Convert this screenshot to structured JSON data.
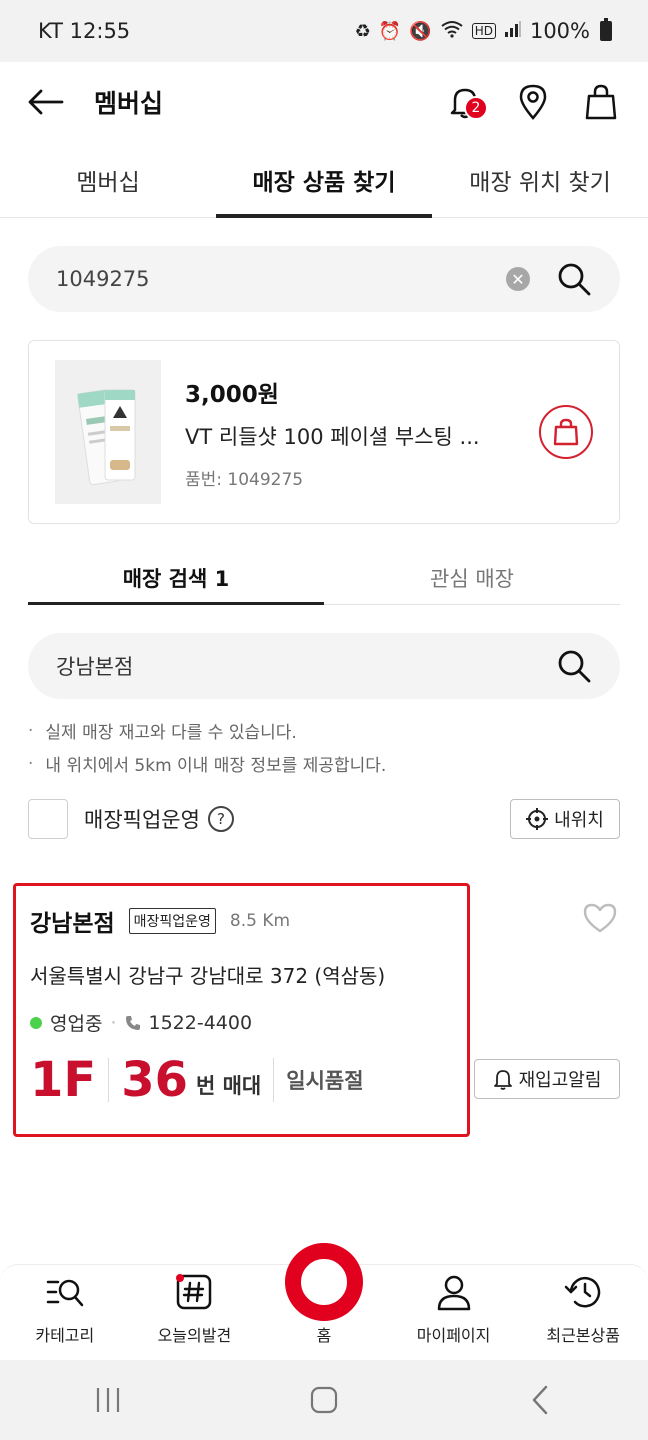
{
  "status_bar": {
    "carrier_time": "KT 12:55",
    "battery": "100%"
  },
  "header": {
    "title": "멤버십",
    "notification_count": "2"
  },
  "tabs": [
    {
      "label": "멤버십"
    },
    {
      "label": "매장 상품 찾기"
    },
    {
      "label": "매장 위치 찾기"
    }
  ],
  "search": {
    "value": "1049275"
  },
  "product": {
    "price": "3,000원",
    "name": "VT 리들샷 100 페이셜 부스팅 ...",
    "code": "품번: 1049275"
  },
  "store_tabs": [
    {
      "label": "매장 검색 1"
    },
    {
      "label": "관심 매장"
    }
  ],
  "store_search": {
    "value": "강남본점"
  },
  "notes": [
    "실제 매장 재고와 다를 수 있습니다.",
    "내 위치에서 5km 이내 매장 정보를 제공합니다."
  ],
  "pickup": {
    "label": "매장픽업운영",
    "help": "?",
    "my_location": "내위치"
  },
  "store": {
    "name": "강남본점",
    "tag": "매장픽업운영",
    "distance": "8.5 Km",
    "address": "서울특별시 강남구 강남대로 372 (역삼동)",
    "status": "영업중",
    "phone": "1522-4400",
    "floor": "1F",
    "stand_no": "36",
    "stand_suffix": "번 매대",
    "stock_status": "일시품절",
    "restock_label": "재입고알림"
  },
  "bottom_nav": [
    {
      "label": "카테고리"
    },
    {
      "label": "오늘의발견"
    },
    {
      "label": "홈"
    },
    {
      "label": "마이페이지"
    },
    {
      "label": "최근본상품"
    }
  ],
  "colors": {
    "accent": "#e1001e",
    "brand_red": "#c8102e",
    "open_green": "#4cd14c"
  }
}
